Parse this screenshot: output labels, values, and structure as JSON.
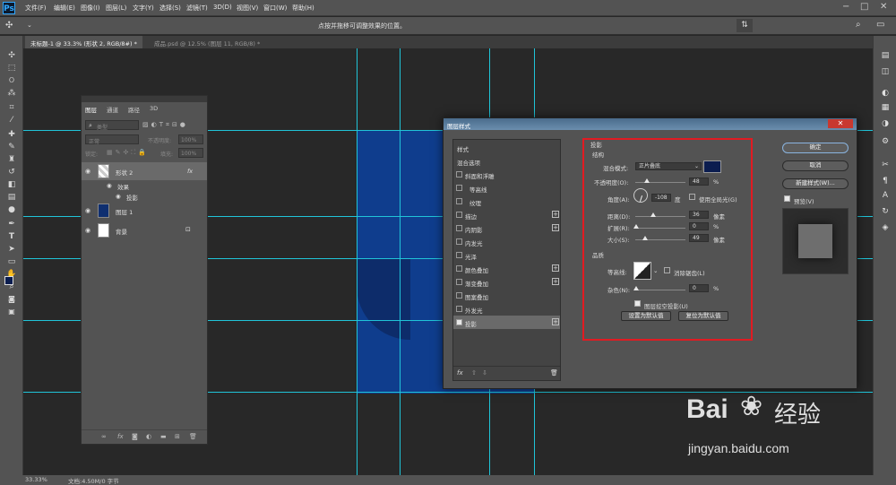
{
  "app": {
    "logo": "Ps"
  },
  "menu": [
    "文件(F)",
    "编辑(E)",
    "图像(I)",
    "图层(L)",
    "文字(Y)",
    "选择(S)",
    "滤镜(T)",
    "3D(D)",
    "视图(V)",
    "窗口(W)",
    "帮助(H)"
  ],
  "options_hint": "点按并拖移可调整效果的位置。",
  "tabs": [
    {
      "label": "未标题-1 @ 33.3% (形状 2, RGB/8#) *",
      "active": true
    },
    {
      "label": "成品.psd @ 12.5% (图层 11, RGB/8) *",
      "active": false
    }
  ],
  "status": {
    "zoom": "33.33%",
    "doc": "文档:4.50M/0 字节"
  },
  "layers_panel": {
    "tabs": [
      "图层",
      "通道",
      "路径",
      "3D"
    ],
    "filter_placeholder": "类型",
    "blend_mode": "正常",
    "opacity_label": "不透明度:",
    "opacity_value": "100%",
    "lock_label": "锁定:",
    "fill_label": "填充:",
    "fill_value": "100%",
    "layers": [
      {
        "name": "形状 2",
        "fx": "fx"
      },
      {
        "name": "效果"
      },
      {
        "name": "投影"
      },
      {
        "name": "图层 1"
      },
      {
        "name": "背景"
      }
    ]
  },
  "dialog": {
    "title": "图层样式",
    "styles_header": "样式",
    "styles": [
      {
        "label": "混合选项",
        "checkbox": false,
        "plus": false,
        "checked": false
      },
      {
        "label": "斜面和浮雕",
        "checkbox": true,
        "plus": false,
        "checked": false
      },
      {
        "label": "等高线",
        "checkbox": true,
        "plus": false,
        "checked": false
      },
      {
        "label": "纹理",
        "checkbox": true,
        "plus": false,
        "checked": false
      },
      {
        "label": "描边",
        "checkbox": true,
        "plus": true,
        "checked": false
      },
      {
        "label": "内阴影",
        "checkbox": true,
        "plus": true,
        "checked": false
      },
      {
        "label": "内发光",
        "checkbox": true,
        "plus": false,
        "checked": false
      },
      {
        "label": "光泽",
        "checkbox": true,
        "plus": false,
        "checked": false
      },
      {
        "label": "颜色叠加",
        "checkbox": true,
        "plus": true,
        "checked": false
      },
      {
        "label": "渐变叠加",
        "checkbox": true,
        "plus": true,
        "checked": false
      },
      {
        "label": "图案叠加",
        "checkbox": true,
        "plus": false,
        "checked": false
      },
      {
        "label": "外发光",
        "checkbox": true,
        "plus": false,
        "checked": false
      },
      {
        "label": "投影",
        "checkbox": true,
        "plus": true,
        "checked": true
      }
    ],
    "section_title": "投影",
    "structure_title": "结构",
    "blend_label": "混合模式:",
    "blend_value": "正片叠底",
    "shadow_color": "#0b1d4f",
    "opacity_label": "不透明度(O):",
    "opacity_value": "48",
    "opacity_unit": "%",
    "angle_label": "角度(A):",
    "angle_value": "-108",
    "angle_unit": "度",
    "global_light_label": "使用全局光(G)",
    "distance_label": "距离(D):",
    "distance_value": "36",
    "distance_unit": "像素",
    "spread_label": "扩展(R):",
    "spread_value": "0",
    "spread_unit": "%",
    "size_label": "大小(S):",
    "size_value": "49",
    "size_unit": "像素",
    "quality_title": "品质",
    "contour_label": "等高线:",
    "antialias_label": "消除锯齿(L)",
    "noise_label": "杂色(N):",
    "noise_value": "0",
    "noise_unit": "%",
    "knockout_label": "图层挖空投影(U)",
    "set_default": "设置为默认值",
    "reset_default": "复位为默认值",
    "ok": "确定",
    "cancel": "取消",
    "new_style": "新建样式(W)...",
    "preview_label": "预览(V)"
  },
  "watermark": {
    "brand": "Bai",
    "brand2": "经验",
    "url": "jingyan.baidu.com"
  },
  "colors": {
    "shape_blue": "#0f3d8d",
    "guide": "#20c4d8",
    "highlight": "#e11b22"
  }
}
